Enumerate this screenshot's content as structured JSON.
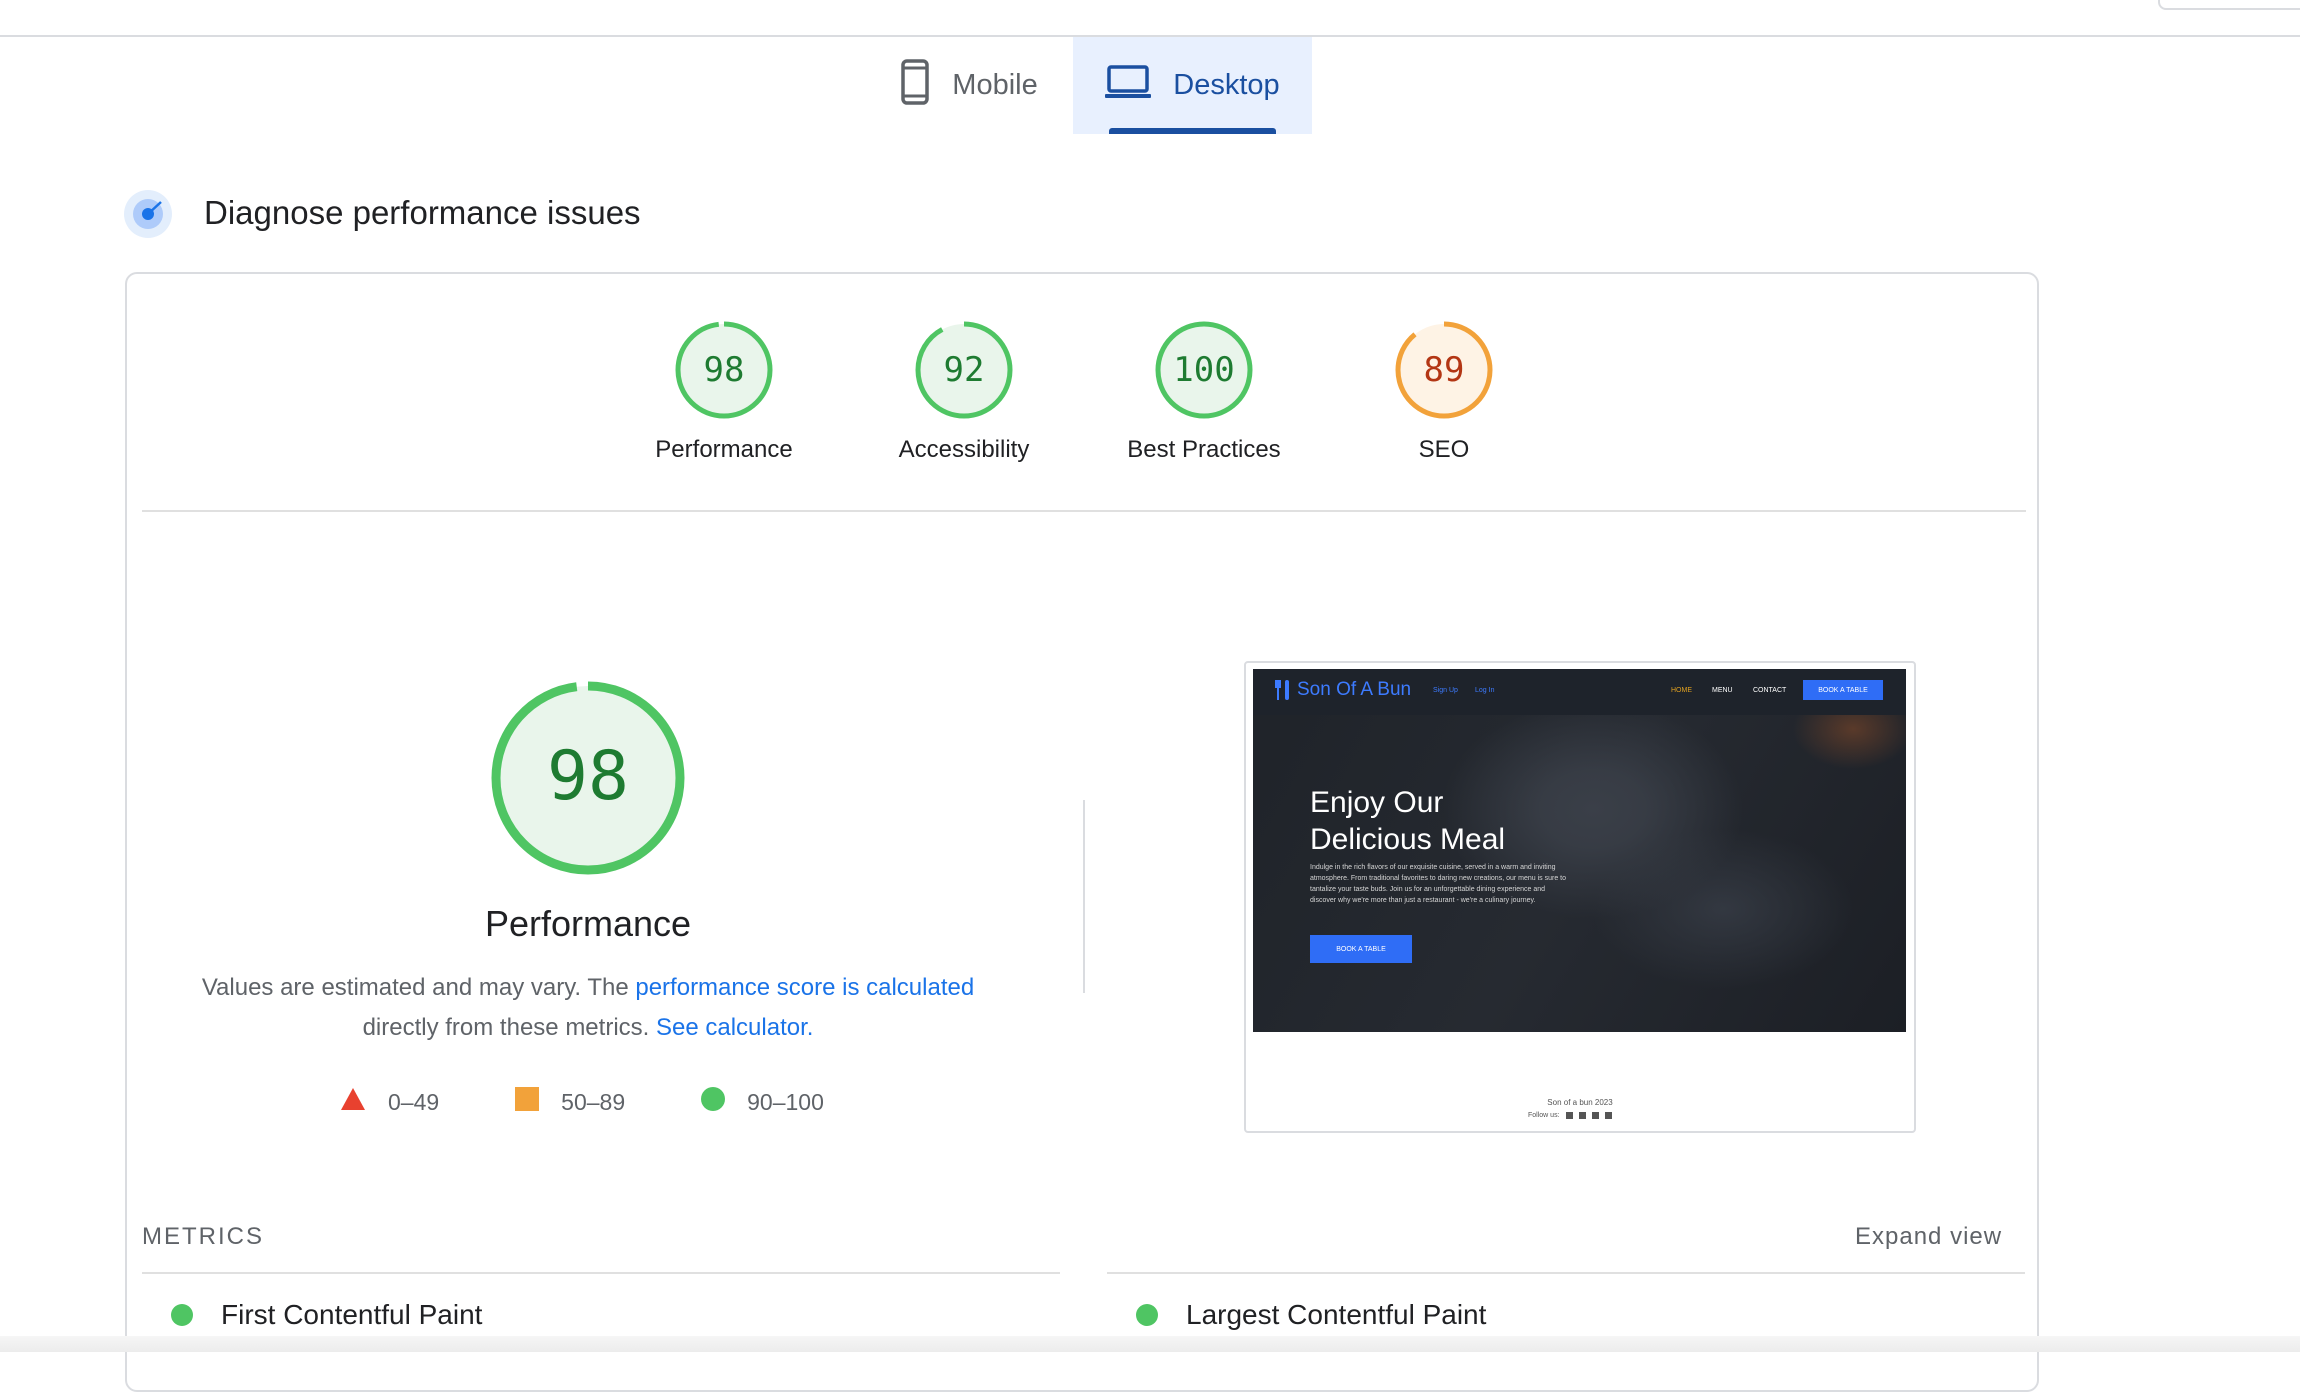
{
  "tabs": {
    "mobile": "Mobile",
    "desktop": "Desktop"
  },
  "section": {
    "title": "Diagnose performance issues"
  },
  "categories": [
    {
      "name": "Performance",
      "score": 98,
      "status": "good"
    },
    {
      "name": "Accessibility",
      "score": 92,
      "status": "good"
    },
    {
      "name": "Best Practices",
      "score": 100,
      "status": "good"
    },
    {
      "name": "SEO",
      "score": 89,
      "status": "average"
    }
  ],
  "colors": {
    "good_stroke": "#4fc563",
    "good_fill": "#e9f5eb",
    "good_text": "#1e7b31",
    "average_stroke": "#f2a23a",
    "average_fill": "#fef3e5",
    "average_text": "#b33614",
    "poor": "#e8412f",
    "link": "#1a73e8",
    "tab_active": "#1a4fa0"
  },
  "performance": {
    "score": "98",
    "title": "Performance",
    "desc_prefix": "Values are estimated and may vary. The ",
    "desc_link1": "performance score is calculated",
    "desc_mid": "directly from these metrics. ",
    "desc_link2": "See calculator."
  },
  "legend": {
    "poor": "0–49",
    "average": "50–89",
    "good": "90–100"
  },
  "thumbnail": {
    "logo": "Son Of A Bun",
    "signup": "Sign Up",
    "login": "Log In",
    "nav_home": "HOME",
    "nav_menu": "MENU",
    "nav_contact": "CONTACT",
    "nav_book": "BOOK A TABLE",
    "heading": "Enjoy Our Delicious Meal",
    "body": "Indulge in the rich flavors of our exquisite cuisine, served in a warm and inviting atmosphere. From traditional favorites to daring new creations, our menu is sure to tantalize your taste buds. Join us for an unforgettable dining experience and discover why we're more than just a restaurant - we're a culinary journey.",
    "cta": "BOOK A TABLE",
    "footer": "Son of a bun 2023",
    "follow": "Follow us:"
  },
  "metrics": {
    "label": "METRICS",
    "expand": "Expand view",
    "items": [
      "First Contentful Paint",
      "Largest Contentful Paint"
    ]
  }
}
